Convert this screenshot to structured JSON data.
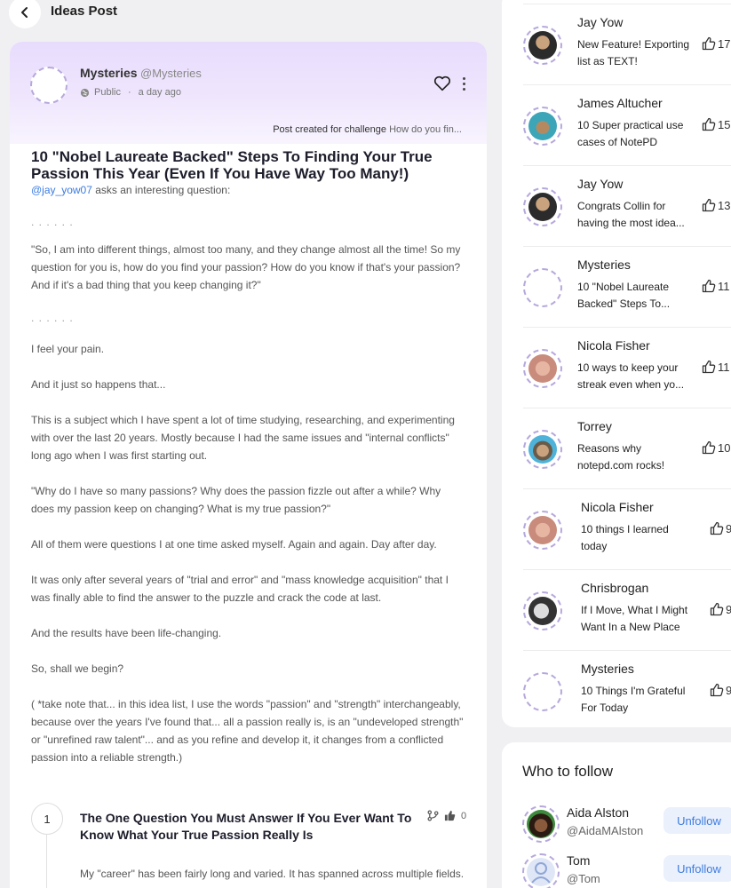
{
  "header": {
    "title": "Ideas Post"
  },
  "post": {
    "author_name": "Mysteries",
    "author_handle": "@Mysteries",
    "visibility": "Public",
    "time": "a day ago",
    "challenge_prefix": "Post created for challenge",
    "challenge_link": "How do you fin...",
    "title": "10 \"Nobel Laureate Backed\" Steps To Finding Your True Passion This Year (Even If You Have Way Too Many!)",
    "intro_mention": "@jay_yow07",
    "intro_text": " asks an interesting question:",
    "dots1": ". . . . . .",
    "quote": "\"So, I am into different things, almost too many, and they change almost all the time! So my question for you is, how do you find your passion? How do you know if that's your passion? And if it's a bad thing that you keep changing it?\"",
    "dots2": ". . . . . .",
    "p1": "I feel your pain.",
    "p2": "And it just so happens that...",
    "p3": "This is a subject which I have spent a lot of time studying, researching, and experimenting with over the last 20 years. Mostly because I had the same issues and \"internal conflicts\" long ago when I was first starting out.",
    "p4": "\"Why do I have so many passions? Why does the passion fizzle out after a while? Why does my passion keep on changing? What is my true passion?\"",
    "p5": "All of them were questions I at one time asked myself. Again and again. Day after day.",
    "p6": "It was only after several years of \"trial and error\" and \"mass knowledge acquisition\" that I was finally able to find the answer to the puzzle and crack the code at last.",
    "p7": "And the results have been life-changing.",
    "p8": "So, shall we begin?",
    "p9": "( *take note that... in this idea list, I use the words \"passion\" and \"strength\" interchangeably, because over the years I've found that... all a passion really is, is an \"undeveloped strength\" or \"unrefined raw talent\"... and as you refine and develop it, it changes from a conflicted passion into a reliable strength.)"
  },
  "idea1": {
    "number": "1",
    "title": "The One Question You Must Answer If You Ever Want To Know What Your True Passion Really Is",
    "likes": "0",
    "text": "My \"career\" has been fairly long and varied. It has spanned across multiple fields."
  },
  "leaderboard": [
    {
      "name": "Jay Yow",
      "desc": "New Feature! Exporting list as TEXT!",
      "likes": "17"
    },
    {
      "name": "James Altucher",
      "desc": "10 Super practical use cases of NotePD",
      "likes": "15"
    },
    {
      "name": "Jay Yow",
      "desc": "Congrats Collin for having the most idea...",
      "likes": "13"
    },
    {
      "name": "Mysteries",
      "desc": "10 \"Nobel Laureate Backed\" Steps To...",
      "likes": "11"
    },
    {
      "name": "Nicola Fisher",
      "desc": "10 ways to keep your streak even when yo...",
      "likes": "11"
    },
    {
      "name": "Torrey",
      "desc": "Reasons why notepd.com rocks!",
      "likes": "10"
    },
    {
      "name": "Nicola Fisher",
      "desc": "10 things I learned today",
      "likes": "9"
    },
    {
      "name": "Chrisbrogan",
      "desc": "If I Move, What I Might Want In a New Place",
      "likes": "9"
    },
    {
      "name": "Mysteries",
      "desc": "10 Things I'm Grateful For Today",
      "likes": "9"
    }
  ],
  "who_to_follow": {
    "title": "Who to follow",
    "users": [
      {
        "name": "Aida Alston",
        "handle": "@AidaMAlston",
        "button": "Unfollow"
      },
      {
        "name": "Tom",
        "handle": "@Tom",
        "button": "Unfollow"
      }
    ]
  },
  "colors": {
    "accent": "#3d7ce0",
    "header_gradient": "#e8dcfd"
  }
}
